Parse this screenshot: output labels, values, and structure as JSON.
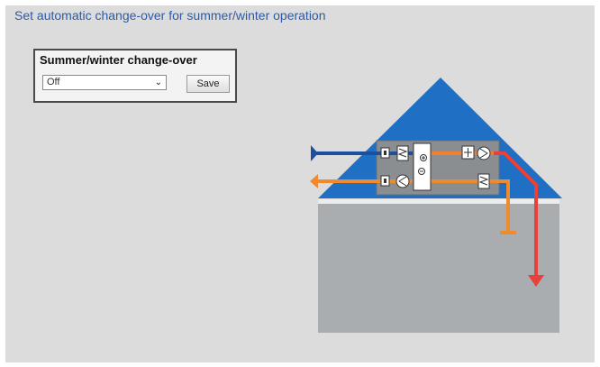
{
  "header": {
    "title": "Set automatic change-over for summer/winter operation"
  },
  "changeover_panel": {
    "title": "Summer/winter change-over",
    "select_value": "Off",
    "save_label": "Save"
  },
  "diagram": {
    "colors": {
      "roof": "#1f6fc5",
      "house": "#a9adb0",
      "unit": "#8a8e91",
      "supply_air": "#e8403a",
      "extract_air": "#f08a2e",
      "outdoor_air": "#1d4fa0"
    }
  }
}
